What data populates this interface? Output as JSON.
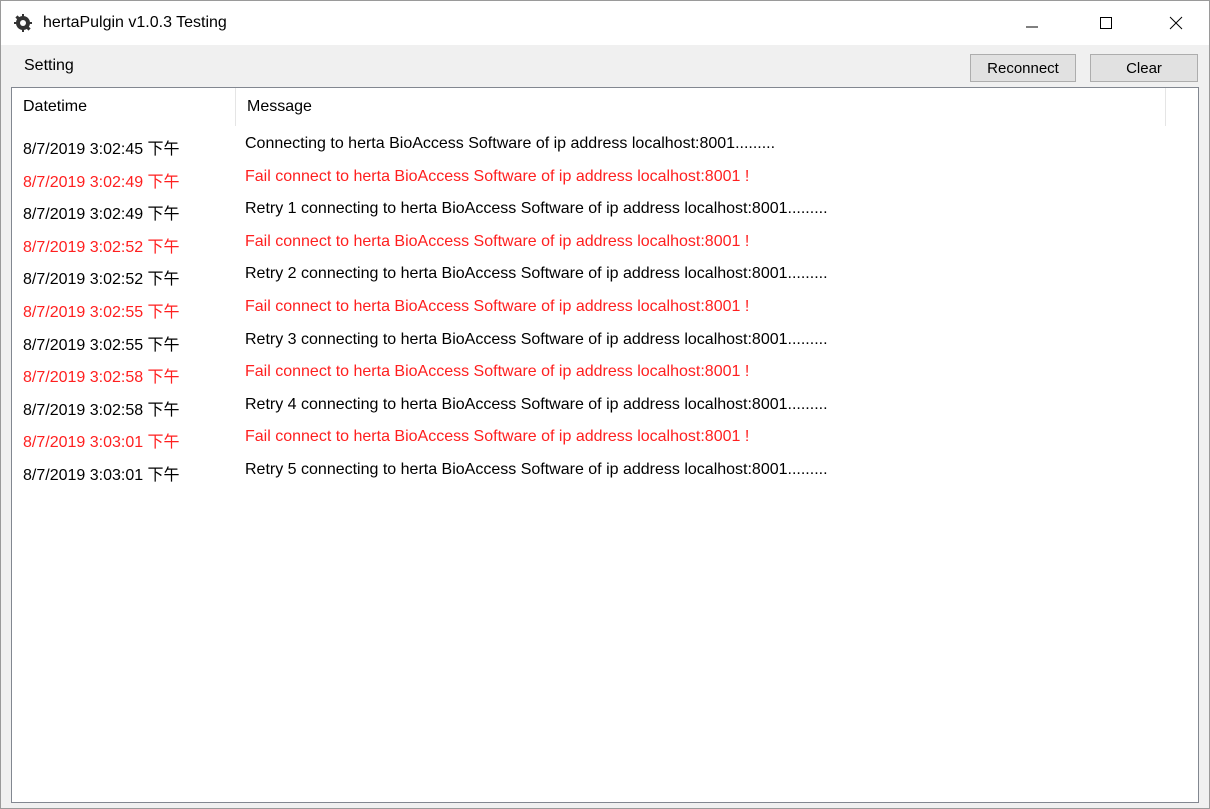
{
  "window": {
    "title": "hertaPulgin v1.0.3 Testing",
    "icon": "app-settings-icon"
  },
  "menu": {
    "setting_label": "Setting"
  },
  "toolbar": {
    "reconnect_label": "Reconnect",
    "clear_label": "Clear"
  },
  "list": {
    "columns": [
      "Datetime",
      "Message"
    ],
    "rows": [
      {
        "datetime": "8/7/2019 3:02:45 下午",
        "message": "Connecting to herta BioAccess Software of ip address localhost:8001.........",
        "status": "normal"
      },
      {
        "datetime": "8/7/2019 3:02:49 下午",
        "message": "Fail connect to herta BioAccess Software of ip address localhost:8001 !",
        "status": "error"
      },
      {
        "datetime": "8/7/2019 3:02:49 下午",
        "message": "Retry 1 connecting to herta BioAccess Software of ip address localhost:8001.........",
        "status": "normal"
      },
      {
        "datetime": "8/7/2019 3:02:52 下午",
        "message": "Fail connect to herta BioAccess Software of ip address localhost:8001 !",
        "status": "error"
      },
      {
        "datetime": "8/7/2019 3:02:52 下午",
        "message": "Retry 2 connecting to herta BioAccess Software of ip address localhost:8001.........",
        "status": "normal"
      },
      {
        "datetime": "8/7/2019 3:02:55 下午",
        "message": "Fail connect to herta BioAccess Software of ip address localhost:8001 !",
        "status": "error"
      },
      {
        "datetime": "8/7/2019 3:02:55 下午",
        "message": "Retry 3 connecting to herta BioAccess Software of ip address localhost:8001.........",
        "status": "normal"
      },
      {
        "datetime": "8/7/2019 3:02:58 下午",
        "message": "Fail connect to herta BioAccess Software of ip address localhost:8001 !",
        "status": "error"
      },
      {
        "datetime": "8/7/2019 3:02:58 下午",
        "message": "Retry 4 connecting to herta BioAccess Software of ip address localhost:8001.........",
        "status": "normal"
      },
      {
        "datetime": "8/7/2019 3:03:01 下午",
        "message": "Fail connect to herta BioAccess Software of ip address localhost:8001 !",
        "status": "error"
      },
      {
        "datetime": "8/7/2019 3:03:01 下午",
        "message": "Retry 5 connecting to herta BioAccess Software of ip address localhost:8001.........",
        "status": "normal"
      }
    ]
  },
  "colors": {
    "error_text": "#ff1f1f",
    "normal_text": "#000000"
  }
}
